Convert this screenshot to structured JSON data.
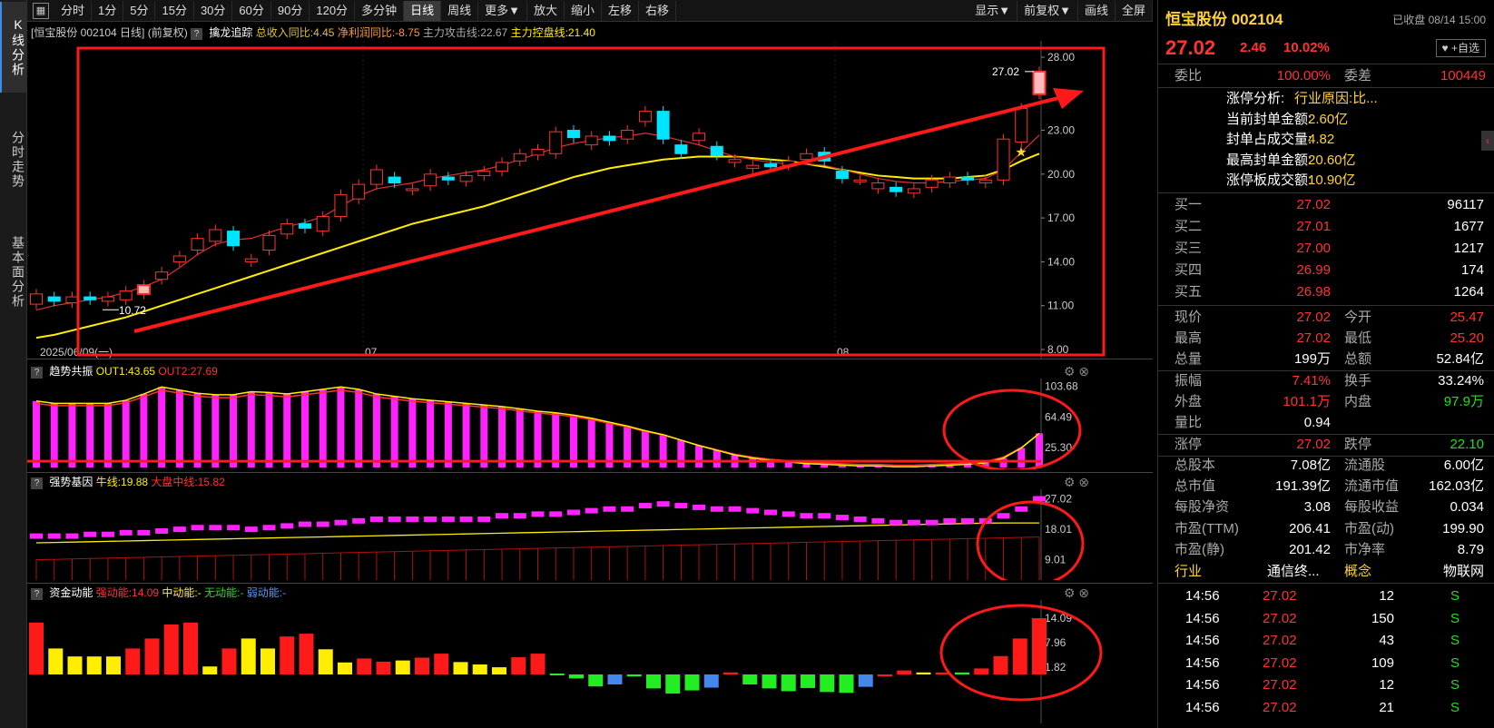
{
  "toolbar": {
    "items": [
      "分时",
      "1分",
      "5分",
      "15分",
      "30分",
      "60分",
      "90分",
      "120分",
      "多分钟",
      "日线",
      "周线",
      "更多▼",
      "放大",
      "缩小",
      "左移",
      "右移",
      "显示▼",
      "前复权▼",
      "画线",
      "全屏"
    ]
  },
  "sidebar": {
    "items": [
      "K线分析",
      "分时走势",
      "基本面分析"
    ]
  },
  "main_panel": {
    "title": "[恒宝股份 002104 日线]",
    "adj": "(前复权)",
    "indicator": "擒龙追踪",
    "m1": "总收入同比:4.45",
    "m2": "净利润同比:-8.75",
    "m3": "主力攻击线:22.67",
    "m4": "主力控盘线:21.40",
    "y_ticks": [
      "28.00",
      "23.00",
      "20.00",
      "17.00",
      "14.00",
      "11.00",
      "8.00"
    ],
    "high_label": "27.02",
    "low_label": "10.72",
    "x_labels": [
      "2025/06/09(一)",
      "07",
      "08"
    ]
  },
  "panel2": {
    "name": "趋势共振",
    "out1": "OUT1:43.65",
    "out2": "OUT2:27.69",
    "y_ticks": [
      "103.68",
      "64.49",
      "25.30"
    ]
  },
  "panel3": {
    "name": "强势基因",
    "l1": "牛线:19.88",
    "l2": "大盘中线:15.82",
    "y_ticks": [
      "27.02",
      "18.01",
      "9.01"
    ]
  },
  "panel4": {
    "name": "资金动能",
    "l1": "强动能:14.09",
    "l2": "中动能:-",
    "l3": "无动能:-",
    "l4": "弱动能:-",
    "y_ticks": [
      "14.09",
      "7.96",
      "1.82"
    ]
  },
  "chart_data": {
    "type": "candlestick",
    "title": "恒宝股份 002104 日线",
    "y_range": [
      8,
      28
    ],
    "close": [
      11.8,
      11.3,
      11.6,
      11.4,
      11.6,
      12.0,
      12.4,
      13.3,
      14.4,
      15.6,
      16.2,
      15.1,
      14.2,
      15.8,
      16.6,
      16.3,
      17.1,
      18.6,
      19.3,
      20.3,
      19.4,
      19.0,
      20.0,
      19.6,
      19.9,
      20.2,
      20.8,
      21.4,
      21.7,
      22.9,
      22.5,
      22.6,
      22.3,
      23.0,
      24.3,
      22.4,
      21.4,
      22.8,
      21.3,
      21.0,
      20.6,
      20.5,
      20.9,
      21.4,
      20.9,
      19.7,
      19.6,
      19.4,
      18.8,
      19.0,
      19.6,
      19.8,
      19.6,
      19.6,
      22.4,
      24.5,
      27.02
    ],
    "open": [
      11.1,
      11.6,
      11.2,
      11.6,
      11.3,
      11.4,
      11.8,
      12.8,
      14.0,
      14.8,
      15.4,
      16.1,
      14.0,
      14.8,
      15.9,
      16.6,
      16.1,
      17.1,
      18.3,
      19.3,
      19.8,
      18.9,
      19.2,
      19.8,
      19.5,
      19.9,
      20.2,
      20.9,
      21.3,
      21.4,
      23.0,
      22.0,
      22.6,
      22.4,
      23.6,
      24.3,
      22.0,
      22.3,
      21.9,
      20.8,
      20.4,
      20.7,
      20.6,
      21.0,
      21.5,
      20.2,
      19.6,
      19.0,
      19.1,
      18.7,
      19.1,
      19.4,
      19.8,
      19.4,
      19.6,
      22.2,
      25.47
    ],
    "ma_fast": [
      10.7,
      11.0,
      11.2,
      11.4,
      11.6,
      11.9,
      12.3,
      12.8,
      13.6,
      14.5,
      15.2,
      15.5,
      15.6,
      16.0,
      16.4,
      16.7,
      17.1,
      17.8,
      18.5,
      19.0,
      19.2,
      19.4,
      19.7,
      19.9,
      20.1,
      20.3,
      20.6,
      21.0,
      21.4,
      21.8,
      22.1,
      22.3,
      22.5,
      22.6,
      22.8,
      22.6,
      22.3,
      22.0,
      21.6,
      21.2,
      21.0,
      20.8,
      20.7,
      20.7,
      20.6,
      20.3,
      20.0,
      19.7,
      19.5,
      19.4,
      19.4,
      19.5,
      19.6,
      19.7,
      20.3,
      21.5,
      22.67
    ],
    "ma_slow": [
      8.8,
      9.0,
      9.3,
      9.6,
      9.9,
      10.2,
      10.6,
      11.0,
      11.4,
      11.8,
      12.2,
      12.6,
      13.0,
      13.4,
      13.8,
      14.2,
      14.6,
      15.0,
      15.4,
      15.8,
      16.2,
      16.6,
      16.9,
      17.2,
      17.5,
      17.8,
      18.2,
      18.6,
      19.0,
      19.4,
      19.8,
      20.1,
      20.4,
      20.6,
      20.8,
      21.0,
      21.1,
      21.2,
      21.2,
      21.2,
      21.1,
      21.0,
      20.9,
      20.7,
      20.5,
      20.3,
      20.1,
      19.9,
      19.8,
      19.7,
      19.7,
      19.7,
      19.8,
      19.9,
      20.3,
      20.9,
      21.4
    ],
    "limit_up_days": [
      6,
      56
    ],
    "panel2_bars": [
      85,
      82,
      82,
      82,
      82,
      86,
      94,
      103,
      99,
      95,
      93,
      93,
      97,
      96,
      94,
      97,
      100,
      103,
      100,
      94,
      91,
      88,
      86,
      84,
      82,
      80,
      78,
      75,
      72,
      70,
      67,
      63,
      58,
      53,
      47,
      42,
      35,
      28,
      22,
      16,
      12,
      9,
      7,
      5,
      4,
      3,
      2,
      2,
      1,
      1,
      2,
      3,
      4,
      6,
      12,
      25,
      43.65
    ],
    "panel3_bars": [
      16,
      16,
      16,
      16.5,
      16.5,
      17,
      17,
      17.5,
      18,
      18.5,
      18.5,
      18.5,
      18,
      18.5,
      19,
      19.5,
      19.5,
      20,
      20.5,
      21,
      21,
      21,
      21,
      21,
      21,
      21,
      22,
      22,
      22.5,
      22.5,
      23,
      23.5,
      24,
      24,
      25,
      25.5,
      25,
      24.5,
      24,
      24,
      23.5,
      23,
      22.5,
      22,
      22,
      21.5,
      21,
      20.5,
      20,
      20,
      20,
      20.5,
      20.5,
      20.5,
      22,
      24,
      27.02
    ],
    "panel4_bars": [
      13,
      6.5,
      4.5,
      4.5,
      4.5,
      6.5,
      9,
      12.5,
      13,
      2,
      6.5,
      9,
      6.5,
      9.5,
      10.2,
      6.3,
      3,
      4,
      3.2,
      3.5,
      4.2,
      5.2,
      3.1,
      2.5,
      1.8,
      4.3,
      5.2,
      0,
      -1,
      -3,
      -2.5,
      -0.5,
      -3.5,
      -4.8,
      -4,
      -3.3,
      0.5,
      -2.5,
      -3.5,
      -4.2,
      -3.4,
      -4.4,
      -4.6,
      -3.1,
      -0.5,
      1,
      0.5,
      0.5,
      0.5,
      1.5,
      4.6,
      9,
      14.09
    ],
    "panel4_colors": [
      "red",
      "yellow",
      "yellow",
      "yellow",
      "yellow",
      "red",
      "red",
      "red",
      "red",
      "yellow",
      "red",
      "yellow",
      "yellow",
      "red",
      "red",
      "yellow",
      "yellow",
      "red",
      "red",
      "yellow",
      "red",
      "red",
      "yellow",
      "yellow",
      "yellow",
      "red",
      "red",
      "green",
      "green",
      "green",
      "blue",
      "green",
      "green",
      "green",
      "green",
      "blue",
      "red",
      "green",
      "green",
      "green",
      "green",
      "green",
      "green",
      "blue",
      "red",
      "red",
      "yellow",
      "red",
      "green",
      "red",
      "red",
      "red",
      "red"
    ]
  },
  "quote": {
    "name": "恒宝股份 002104",
    "status": "已收盘 08/14 15:00",
    "price": "27.02",
    "change": "2.46",
    "pct": "10.02%",
    "watch": "♥ +自选",
    "weibi_label": "委比",
    "weibi": "100.00%",
    "weicha_label": "委差",
    "weicha": "100449",
    "limit_lines": [
      {
        "k": "涨停分析:",
        "v": "行业原因:比..."
      },
      {
        "k": "当前封单金额:",
        "v": "2.60亿"
      },
      {
        "k": "封单占成交量:",
        "v": "4.82"
      },
      {
        "k": "最高封单金额:",
        "v": "20.60亿"
      },
      {
        "k": "涨停板成交额:",
        "v": "10.90亿"
      }
    ],
    "book": [
      {
        "l": "买一",
        "p": "27.02",
        "v": "96117"
      },
      {
        "l": "买二",
        "p": "27.01",
        "v": "1677"
      },
      {
        "l": "买三",
        "p": "27.00",
        "v": "1217"
      },
      {
        "l": "买四",
        "p": "26.99",
        "v": "174"
      },
      {
        "l": "买五",
        "p": "26.98",
        "v": "1264"
      }
    ],
    "stats": [
      {
        "a": "现价",
        "av": "27.02",
        "b": "今开",
        "bv": "25.47",
        "ac": "red",
        "bc": "red"
      },
      {
        "a": "最高",
        "av": "27.02",
        "b": "最低",
        "bv": "25.20",
        "ac": "red",
        "bc": "red"
      },
      {
        "a": "总量",
        "av": "199万",
        "b": "总额",
        "bv": "52.84亿",
        "ac": "white",
        "bc": "white"
      },
      {
        "a": "振幅",
        "av": "7.41%",
        "b": "换手",
        "bv": "33.24%",
        "ac": "red",
        "bc": "white"
      },
      {
        "a": "外盘",
        "av": "101.1万",
        "b": "内盘",
        "bv": "97.9万",
        "ac": "red",
        "bc": "green"
      },
      {
        "a": "量比",
        "av": "0.94",
        "b": "",
        "bv": "",
        "ac": "white",
        "bc": "white"
      },
      {
        "a": "涨停",
        "av": "27.02",
        "b": "跌停",
        "bv": "22.10",
        "ac": "red",
        "bc": "green"
      },
      {
        "a": "总股本",
        "av": "7.08亿",
        "b": "流通股",
        "bv": "6.00亿",
        "ac": "white",
        "bc": "white"
      },
      {
        "a": "总市值",
        "av": "191.39亿",
        "b": "流通市值",
        "bv": "162.03亿",
        "ac": "white",
        "bc": "white"
      },
      {
        "a": "每股净资",
        "av": "3.08",
        "b": "每股收益",
        "bv": "0.034",
        "ac": "white",
        "bc": "white"
      },
      {
        "a": "市盈(TTM)",
        "av": "206.41",
        "b": "市盈(动)",
        "bv": "199.90",
        "ac": "white",
        "bc": "white"
      },
      {
        "a": "市盈(静)",
        "av": "201.42",
        "b": "市净率",
        "bv": "8.79",
        "ac": "white",
        "bc": "white"
      }
    ],
    "industry_label": "行业",
    "industry": "通信终...",
    "concept_label": "概念",
    "concept": "物联网",
    "ticks": [
      {
        "t": "14:56",
        "p": "27.02",
        "v": "12",
        "s": "S"
      },
      {
        "t": "14:56",
        "p": "27.02",
        "v": "150",
        "s": "S"
      },
      {
        "t": "14:56",
        "p": "27.02",
        "v": "43",
        "s": "S"
      },
      {
        "t": "14:56",
        "p": "27.02",
        "v": "109",
        "s": "S"
      },
      {
        "t": "14:56",
        "p": "27.02",
        "v": "12",
        "s": "S"
      },
      {
        "t": "14:56",
        "p": "27.02",
        "v": "21",
        "s": "S"
      }
    ]
  },
  "colors": {
    "up": "#ff3333",
    "down": "#00e5ff",
    "yellow": "#ffee00",
    "magenta": "#ff22ff",
    "annot": "#ff1a1a"
  }
}
